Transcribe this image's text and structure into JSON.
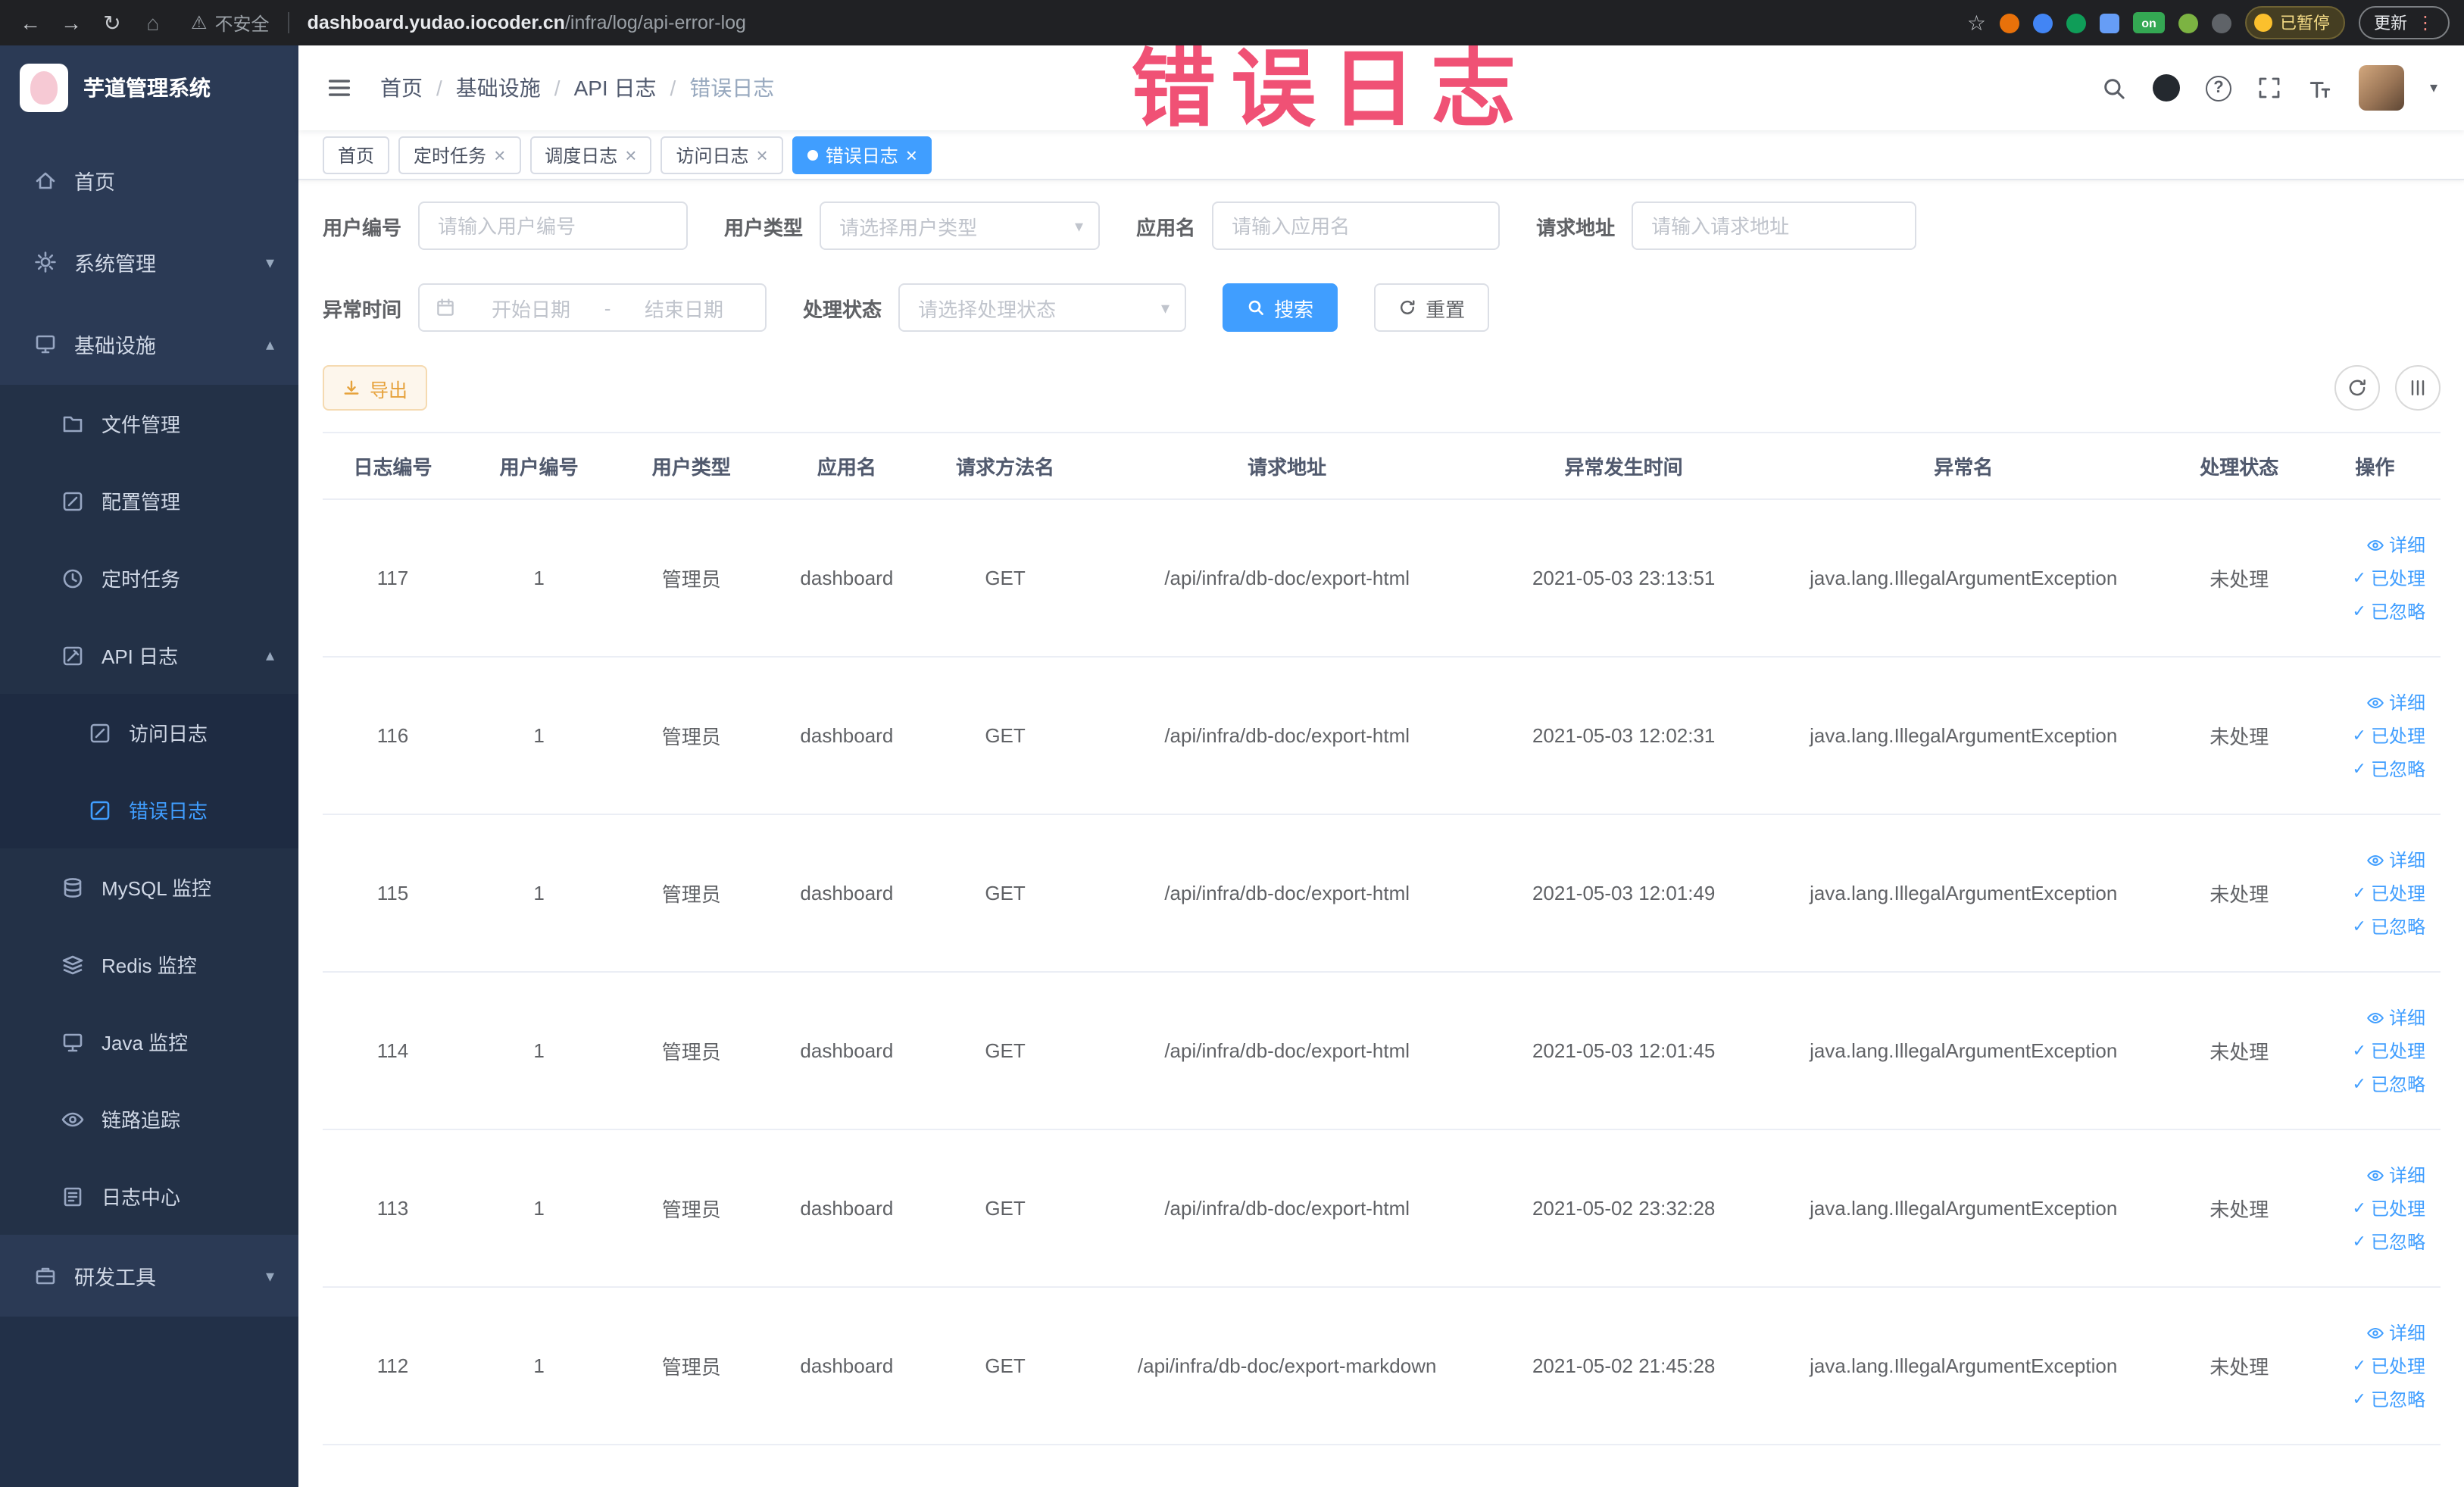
{
  "colors": {
    "accent": "#409eff",
    "watermark": "#f0486e",
    "sidebar_bg": "#2b3a55",
    "warning_text": "#e6a23c",
    "active_tab_bg": "#409eff"
  },
  "watermark": "错误日志",
  "browser": {
    "security_label": "不安全",
    "url_domain": "dashboard.yudao.iocoder.cn",
    "url_path": "/infra/log/api-error-log",
    "extension_on_label": "on",
    "paused_badge": "已暂停",
    "update_button": "更新"
  },
  "icons": {
    "back": "←",
    "forward": "→",
    "reload": "↻",
    "home": "⌂",
    "warning": "⚠",
    "star": "☆",
    "more": "⋮",
    "close": "×",
    "caret_down": "▾",
    "caret_up": "▴",
    "check": "✓",
    "question": "?",
    "breadcrumb_separator": "/"
  },
  "sidebar": {
    "logo_title": "芋道管理系统",
    "items": [
      {
        "label": "首页"
      },
      {
        "label": "系统管理"
      },
      {
        "label": "基础设施"
      },
      {
        "label": "文件管理"
      },
      {
        "label": "配置管理"
      },
      {
        "label": "定时任务"
      },
      {
        "label": "API 日志"
      },
      {
        "label": "访问日志"
      },
      {
        "label": "错误日志"
      },
      {
        "label": "MySQL 监控"
      },
      {
        "label": "Redis 监控"
      },
      {
        "label": "Java 监控"
      },
      {
        "label": "链路追踪"
      },
      {
        "label": "日志中心"
      },
      {
        "label": "研发工具"
      }
    ]
  },
  "breadcrumb": {
    "items": [
      {
        "label": "首页"
      },
      {
        "label": "基础设施"
      },
      {
        "label": "API 日志"
      },
      {
        "label": "错误日志"
      }
    ]
  },
  "tabs": [
    {
      "label": "首页"
    },
    {
      "label": "定时任务"
    },
    {
      "label": "调度日志"
    },
    {
      "label": "访问日志"
    },
    {
      "label": "错误日志"
    }
  ],
  "filters": {
    "user_id": {
      "label": "用户编号",
      "placeholder": "请输入用户编号"
    },
    "user_type": {
      "label": "用户类型",
      "placeholder": "请选择用户类型"
    },
    "app_name": {
      "label": "应用名",
      "placeholder": "请输入应用名"
    },
    "request_url": {
      "label": "请求地址",
      "placeholder": "请输入请求地址"
    },
    "exception_time": {
      "label": "异常时间",
      "start_placeholder": "开始日期",
      "separator": "-",
      "end_placeholder": "结束日期"
    },
    "process_status": {
      "label": "处理状态",
      "placeholder": "请选择处理状态"
    },
    "search_button": "搜索",
    "reset_button": "重置"
  },
  "toolbar": {
    "export_label": "导出"
  },
  "table": {
    "columns": [
      "日志编号",
      "用户编号",
      "用户类型",
      "应用名",
      "请求方法名",
      "请求地址",
      "异常发生时间",
      "异常名",
      "处理状态",
      "操作"
    ],
    "actions": {
      "detail": "详细",
      "processed": "已处理",
      "ignored": "已忽略"
    },
    "rows": [
      {
        "id": "117",
        "user_id": "1",
        "user_type": "管理员",
        "app": "dashboard",
        "method": "GET",
        "url": "/api/infra/db-doc/export-html",
        "time": "2021-05-03 23:13:51",
        "exception": "java.lang.IllegalArgumentException",
        "status": "未处理"
      },
      {
        "id": "116",
        "user_id": "1",
        "user_type": "管理员",
        "app": "dashboard",
        "method": "GET",
        "url": "/api/infra/db-doc/export-html",
        "time": "2021-05-03 12:02:31",
        "exception": "java.lang.IllegalArgumentException",
        "status": "未处理"
      },
      {
        "id": "115",
        "user_id": "1",
        "user_type": "管理员",
        "app": "dashboard",
        "method": "GET",
        "url": "/api/infra/db-doc/export-html",
        "time": "2021-05-03 12:01:49",
        "exception": "java.lang.IllegalArgumentException",
        "status": "未处理"
      },
      {
        "id": "114",
        "user_id": "1",
        "user_type": "管理员",
        "app": "dashboard",
        "method": "GET",
        "url": "/api/infra/db-doc/export-html",
        "time": "2021-05-03 12:01:45",
        "exception": "java.lang.IllegalArgumentException",
        "status": "未处理"
      },
      {
        "id": "113",
        "user_id": "1",
        "user_type": "管理员",
        "app": "dashboard",
        "method": "GET",
        "url": "/api/infra/db-doc/export-html",
        "time": "2021-05-02 23:32:28",
        "exception": "java.lang.IllegalArgumentException",
        "status": "未处理"
      },
      {
        "id": "112",
        "user_id": "1",
        "user_type": "管理员",
        "app": "dashboard",
        "method": "GET",
        "url": "/api/infra/db-doc/export-markdown",
        "time": "2021-05-02 21:45:28",
        "exception": "java.lang.IllegalArgumentException",
        "status": "未处理"
      }
    ]
  }
}
